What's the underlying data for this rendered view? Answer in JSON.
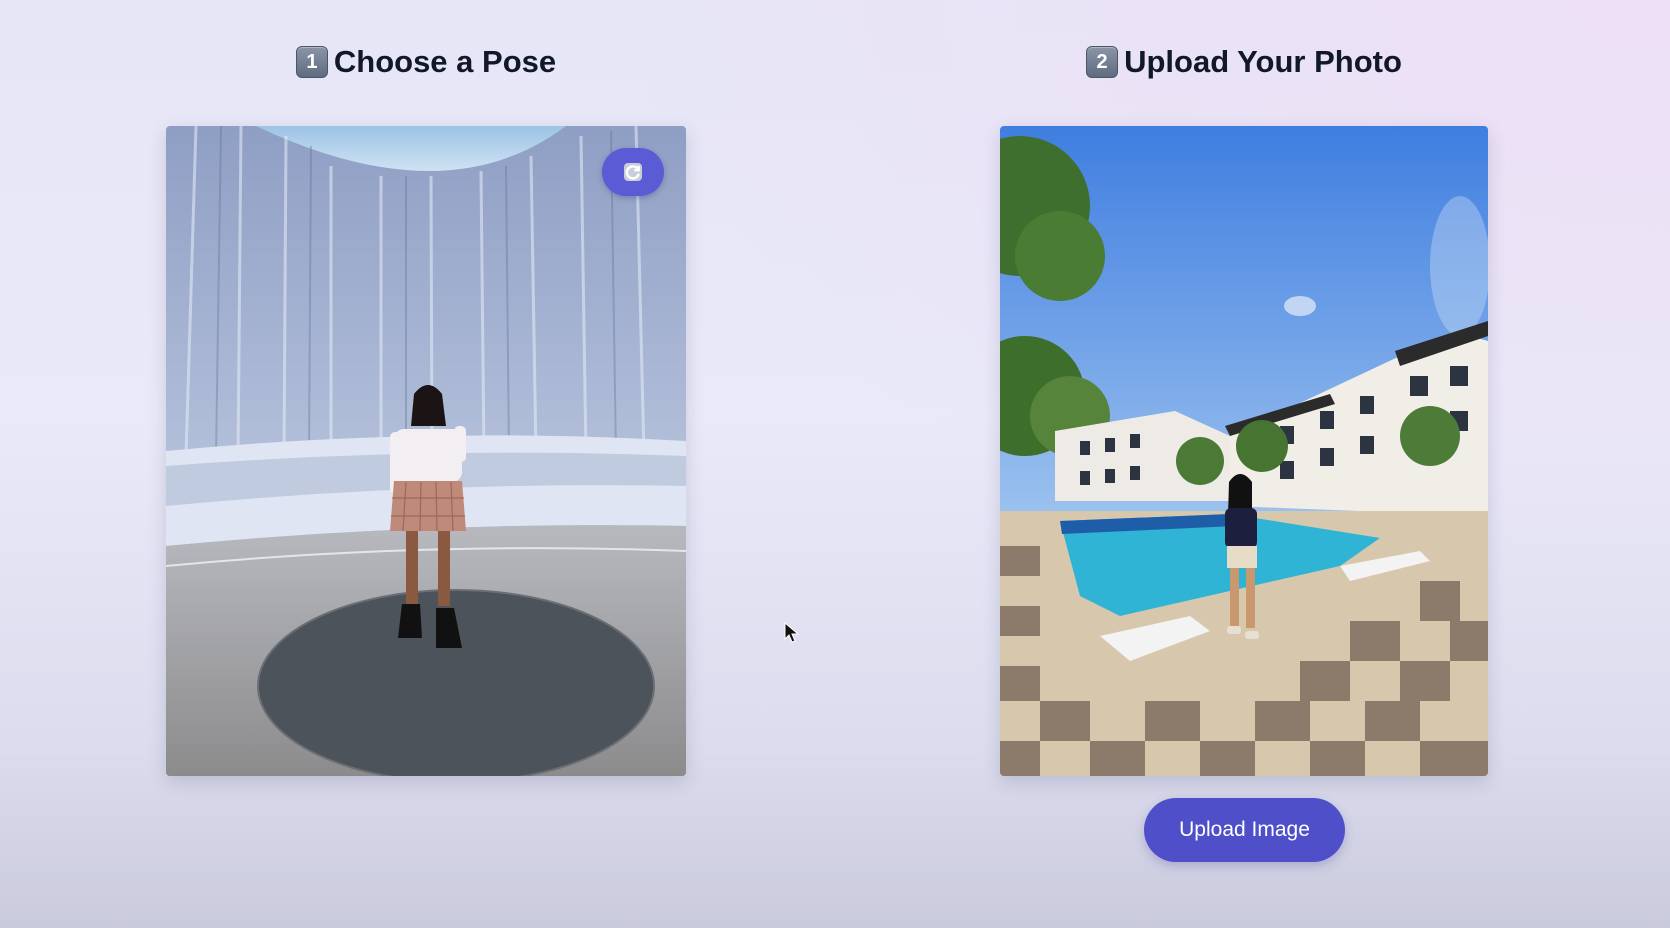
{
  "pose": {
    "step_number": "1",
    "title": "Choose a Pose",
    "image_description_icon": "woman-at-waterwall-photo",
    "refresh_icon": "refresh-icon"
  },
  "upload": {
    "step_number": "2",
    "title": "Upload Your Photo",
    "image_description_icon": "woman-at-pool-photo",
    "button_label": "Upload Image"
  },
  "colors": {
    "accent": "#5b5bd6",
    "button": "#4f4fc9",
    "heading": "#111827"
  }
}
